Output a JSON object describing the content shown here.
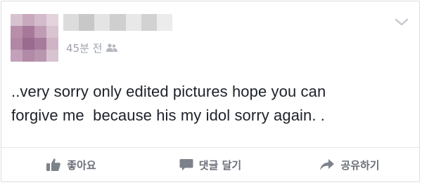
{
  "post": {
    "time": "45분 전",
    "audience_icon": "friends-icon",
    "text": "..very sorry only edited pictures hope you can\nforgive me  because his my idol sorry again. ."
  },
  "actions": {
    "like_label": "좋아요",
    "comment_label": "댓글 달기",
    "share_label": "공유하기"
  },
  "colors": {
    "text": "#1d2129",
    "muted": "#9ea3ab",
    "action": "#6b7079"
  }
}
